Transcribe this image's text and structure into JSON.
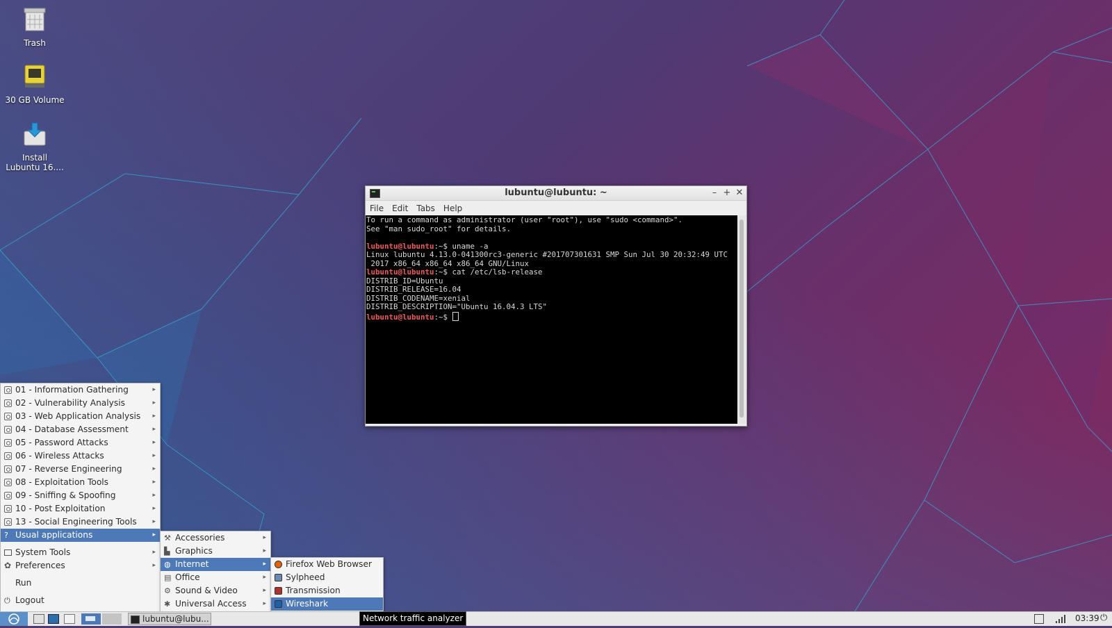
{
  "desktop": {
    "icons": [
      {
        "label": "Trash"
      },
      {
        "label": "30 GB Volume"
      },
      {
        "label": "Install Lubuntu 16...."
      }
    ]
  },
  "terminal": {
    "title": "lubuntu@lubuntu: ~",
    "menu": [
      "File",
      "Edit",
      "Tabs",
      "Help"
    ],
    "prompt": "lubuntu@lubuntu",
    "prompt_suffix": ":~$ ",
    "lines": [
      {
        "text": "To run a command as administrator (user \"root\"), use \"sudo <command>\"."
      },
      {
        "text": "See \"man sudo_root\" for details."
      },
      {
        "text": ""
      },
      {
        "cmd": "uname -a"
      },
      {
        "text": "Linux lubuntu 4.13.0-041300rc3-generic #201707301631 SMP Sun Jul 30 20:32:49 UTC"
      },
      {
        "text": " 2017 x86_64 x86_64 x86_64 GNU/Linux"
      },
      {
        "cmd": "cat /etc/lsb-release"
      },
      {
        "text": "DISTRIB_ID=Ubuntu"
      },
      {
        "text": "DISTRIB_RELEASE=16.04"
      },
      {
        "text": "DISTRIB_CODENAME=xenial"
      },
      {
        "text": "DISTRIB_DESCRIPTION=\"Ubuntu 16.04.3 LTS\""
      },
      {
        "cmd": "",
        "cursor": true
      }
    ]
  },
  "main_menu": {
    "categories": [
      "01 - Information Gathering",
      "02 - Vulnerability Analysis",
      "03 - Web Application Analysis",
      "04 - Database Assessment",
      "05 - Password Attacks",
      "06 - Wireless Attacks",
      "07 - Reverse Engineering",
      "08 - Exploitation Tools",
      "09 - Sniffing & Spoofing",
      "10 - Post Exploitation",
      "13 - Social Engineering Tools"
    ],
    "usual": "Usual applications",
    "system_tools": "System Tools",
    "preferences": "Preferences",
    "run": "Run",
    "logout": "Logout"
  },
  "usual_menu": {
    "items": [
      "Accessories",
      "Graphics",
      "Internet",
      "Office",
      "Sound & Video",
      "Universal Access"
    ]
  },
  "internet_menu": {
    "items": [
      "Firefox Web Browser",
      "Sylpheed",
      "Transmission",
      "Wireshark"
    ]
  },
  "tooltip": "Network traffic analyzer",
  "taskbar": {
    "task_label": "lubuntu@lubu...",
    "clock": "03:39"
  }
}
